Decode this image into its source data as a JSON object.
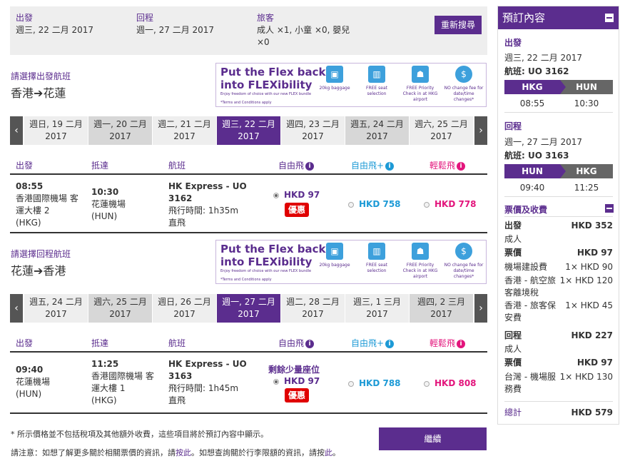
{
  "colors": {
    "brand": "#5b2d8e",
    "blue": "#1d9ad6",
    "magenta": "#e3157c",
    "deal": "#e00000"
  },
  "search": {
    "depart_label": "出發",
    "depart_value": "週三, 22 二月 2017",
    "return_label": "回程",
    "return_value": "週一, 27 二月 2017",
    "pax_label": "旅客",
    "pax_value_1": "成人 ×1, 小童 ×0, 嬰兒",
    "pax_value_2": "×0",
    "research_button": "重新搜尋"
  },
  "banner": {
    "title_1": "Put the Flex back",
    "title_2": "into FLEXibility",
    "subtitle": "Enjoy freedom of choice with our new FLEX bundle",
    "terms": "*Terms and Conditions apply",
    "features": [
      {
        "icon": "luggage-icon",
        "caption": "20kg baggage"
      },
      {
        "icon": "seat-icon",
        "caption": "FREE seat selection"
      },
      {
        "icon": "priority-checkin-icon",
        "caption": "FREE Priority Check in at HKG airport"
      },
      {
        "icon": "no-fee-icon",
        "caption": "NO change fee for date/time changes*"
      }
    ]
  },
  "outbound": {
    "section_title": "請選擇出發航班",
    "from": "香港",
    "to": "花蓮",
    "dates": [
      {
        "day": "週日, 19 二月",
        "year": "2017"
      },
      {
        "day": "週一, 20 二月",
        "year": "2017"
      },
      {
        "day": "週二, 21 二月",
        "year": "2017"
      },
      {
        "day": "週三, 22 二月",
        "year": "2017"
      },
      {
        "day": "週四, 23 二月",
        "year": "2017"
      },
      {
        "day": "週五, 24 二月",
        "year": "2017"
      },
      {
        "day": "週六, 25 二月",
        "year": "2017"
      }
    ],
    "selected_date_index": 3,
    "flight": {
      "dep_time": "08:55",
      "dep_airport_1": "香港國際機場 客",
      "dep_airport_2": "運大樓 2",
      "dep_code": "(HKG)",
      "arr_time": "10:30",
      "arr_airport_1": "花蓮機場",
      "arr_code": "(HUN)",
      "airline": "HK Express - UO",
      "flight_no": "3162",
      "duration": "飛行時間: 1h35m",
      "stops": "直飛",
      "fare_basic": "HKD 97",
      "deal_badge": "優惠",
      "fare_plus": "HKD 758",
      "fare_max": "HKD 778"
    }
  },
  "inbound": {
    "section_title": "請選擇回程航班",
    "from": "花蓮",
    "to": "香港",
    "dates": [
      {
        "day": "週五, 24 二月",
        "year": "2017"
      },
      {
        "day": "週六, 25 二月",
        "year": "2017"
      },
      {
        "day": "週日, 26 二月",
        "year": "2017"
      },
      {
        "day": "週一, 27 二月",
        "year": "2017"
      },
      {
        "day": "週二, 28 二月",
        "year": "2017"
      },
      {
        "day": "週三, 1 三月",
        "year": "2017"
      },
      {
        "day": "週四, 2 三月",
        "year": "2017"
      }
    ],
    "selected_date_index": 3,
    "flight": {
      "dep_time": "09:40",
      "dep_airport_1": "花蓮機場",
      "dep_code": "(HUN)",
      "arr_time": "11:25",
      "arr_airport_1": "香港國際機場 客",
      "arr_airport_2": "運大樓 1",
      "arr_code": "(HKG)",
      "airline": "HK Express - UO",
      "flight_no": "3163",
      "duration": "飛行時間: 1h45m",
      "stops": "直飛",
      "few_seats": "剩餘少量座位",
      "fare_basic": "HKD 97",
      "deal_badge": "優惠",
      "fare_plus": "HKD 788",
      "fare_max": "HKD 808"
    }
  },
  "table_headers": {
    "depart": "出發",
    "arrive": "抵達",
    "flight": "航班",
    "basic": "自由飛",
    "plus": "自由飛+",
    "max": "輕鬆飛"
  },
  "footer": {
    "note_1": "* 所示價格並不包括稅項及其他額外收費，這些項目將於預訂內容中顯示。",
    "note_2a": "請注意：如想了解更多關於相關票價的資訊，請",
    "link_1": "按此",
    "note_2b": "。如想查詢關於行李限額的資訊，請按",
    "link_2": "此",
    "note_2c": "。",
    "continue_button": "繼續"
  },
  "side": {
    "title": "預訂內容",
    "out_label": "出發",
    "out_date": "週三, 22 二月 2017",
    "out_flight": "航班: UO 3162",
    "out_from": "HKG",
    "out_to": "HUN",
    "out_dep": "08:55",
    "out_arr": "10:30",
    "ret_label": "回程",
    "ret_date": "週一, 27 二月 2017",
    "ret_flight": "航班: UO 3163",
    "ret_from": "HUN",
    "ret_to": "HKG",
    "ret_dep": "09:40",
    "ret_arr": "11:25",
    "fees_title": "票價及收費",
    "out_total_label": "出發",
    "out_total": "HKD 352",
    "adult": "成人",
    "fare_label": "票價",
    "out_fare": "HKD 97",
    "out_items": [
      {
        "l": "機場建設費",
        "r": "1× HKD 90"
      },
      {
        "l": "香港 - 航空旅客離境稅",
        "r": "1× HKD 120"
      },
      {
        "l": "香港 - 旅客保安費",
        "r": "1× HKD 45"
      }
    ],
    "ret_total_label": "回程",
    "ret_total": "HKD 227",
    "ret_fare": "HKD 97",
    "ret_items": [
      {
        "l": "台灣 - 機場服務費",
        "r": "1× HKD 130"
      }
    ],
    "grand_label": "總計",
    "grand_total": "HKD 579"
  }
}
